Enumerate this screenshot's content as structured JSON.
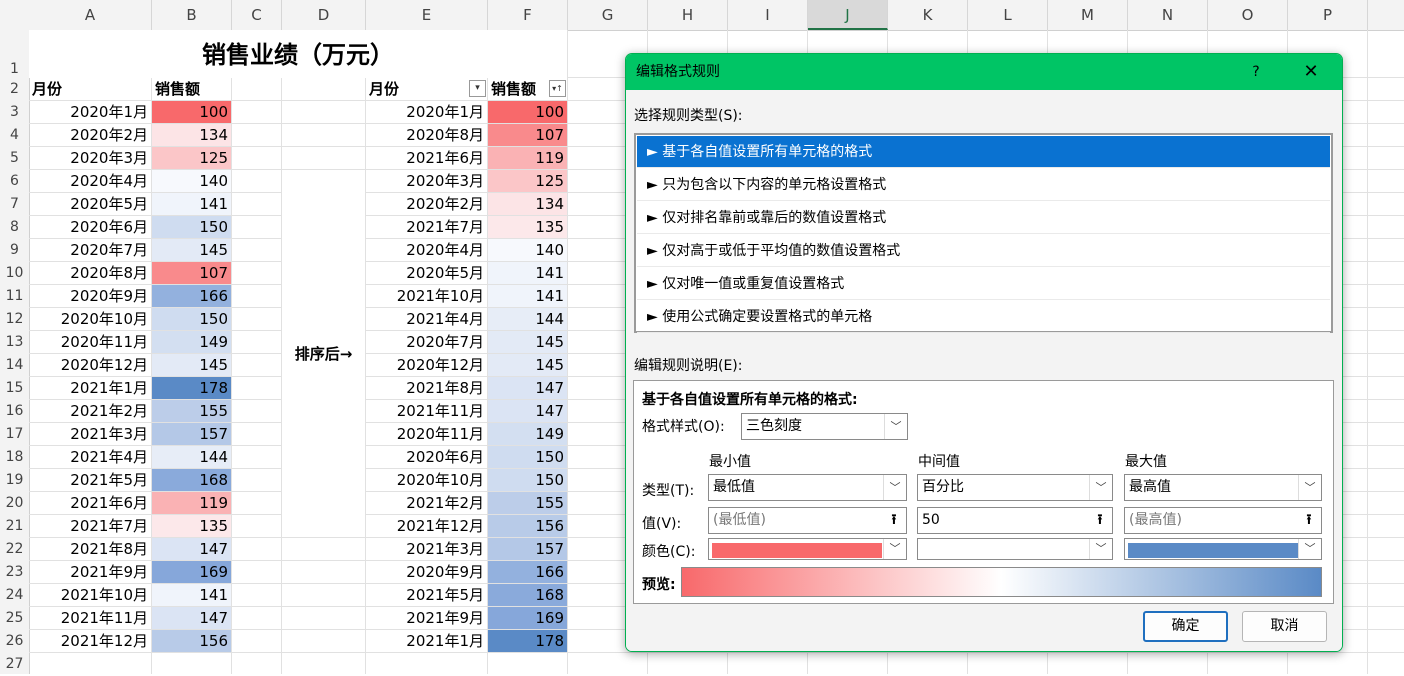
{
  "columns": [
    {
      "name": "A",
      "w": 123
    },
    {
      "name": "B",
      "w": 80
    },
    {
      "name": "C",
      "w": 50
    },
    {
      "name": "D",
      "w": 84
    },
    {
      "name": "E",
      "w": 122
    },
    {
      "name": "F",
      "w": 80
    },
    {
      "name": "G",
      "w": 80
    },
    {
      "name": "H",
      "w": 80
    },
    {
      "name": "I",
      "w": 80
    },
    {
      "name": "J",
      "w": 80
    },
    {
      "name": "K",
      "w": 80
    },
    {
      "name": "L",
      "w": 80
    },
    {
      "name": "M",
      "w": 80
    },
    {
      "name": "N",
      "w": 80
    },
    {
      "name": "O",
      "w": 80
    },
    {
      "name": "P",
      "w": 80
    }
  ],
  "selected_column": "J",
  "rows": [
    "1",
    "2",
    "3",
    "4",
    "5",
    "6",
    "7",
    "8",
    "9",
    "10",
    "11",
    "12",
    "13",
    "14",
    "15",
    "16",
    "17",
    "18",
    "19",
    "20",
    "21",
    "22",
    "23",
    "24",
    "25",
    "26",
    "27"
  ],
  "sheet": {
    "title": "销售业绩（万元）",
    "header_month": "月份",
    "header_sales": "销售额",
    "sort_label": "排序后→",
    "left_table": [
      {
        "month": "2020年1月",
        "value": "100",
        "color": "#f8696b"
      },
      {
        "month": "2020年2月",
        "value": "134",
        "color": "#fce4e6"
      },
      {
        "month": "2020年3月",
        "value": "125",
        "color": "#fbc6c8"
      },
      {
        "month": "2020年4月",
        "value": "140",
        "color": "#f7f9fd"
      },
      {
        "month": "2020年5月",
        "value": "141",
        "color": "#f0f4fb"
      },
      {
        "month": "2020年6月",
        "value": "150",
        "color": "#cfdcf0"
      },
      {
        "month": "2020年7月",
        "value": "145",
        "color": "#e3eaf6"
      },
      {
        "month": "2020年8月",
        "value": "107",
        "color": "#f98a8c"
      },
      {
        "month": "2020年9月",
        "value": "166",
        "color": "#93b1de"
      },
      {
        "month": "2020年10月",
        "value": "150",
        "color": "#cfdcf0"
      },
      {
        "month": "2020年11月",
        "value": "149",
        "color": "#d3dff1"
      },
      {
        "month": "2020年12月",
        "value": "145",
        "color": "#e3eaf6"
      },
      {
        "month": "2021年1月",
        "value": "178",
        "color": "#5a8ac6"
      },
      {
        "month": "2021年2月",
        "value": "155",
        "color": "#bccde9"
      },
      {
        "month": "2021年3月",
        "value": "157",
        "color": "#b4c8e7"
      },
      {
        "month": "2021年4月",
        "value": "144",
        "color": "#e7edf7"
      },
      {
        "month": "2021年5月",
        "value": "168",
        "color": "#8aaadb"
      },
      {
        "month": "2021年6月",
        "value": "119",
        "color": "#fab2b4"
      },
      {
        "month": "2021年7月",
        "value": "135",
        "color": "#fce8ea"
      },
      {
        "month": "2021年8月",
        "value": "147",
        "color": "#dbe4f4"
      },
      {
        "month": "2021年9月",
        "value": "169",
        "color": "#86a7da"
      },
      {
        "month": "2021年10月",
        "value": "141",
        "color": "#f0f4fb"
      },
      {
        "month": "2021年11月",
        "value": "147",
        "color": "#dbe4f4"
      },
      {
        "month": "2021年12月",
        "value": "156",
        "color": "#b8cbe8"
      }
    ],
    "right_table": [
      {
        "month": "2020年1月",
        "value": "100",
        "color": "#f8696b"
      },
      {
        "month": "2020年8月",
        "value": "107",
        "color": "#f98a8c"
      },
      {
        "month": "2021年6月",
        "value": "119",
        "color": "#fab2b4"
      },
      {
        "month": "2020年3月",
        "value": "125",
        "color": "#fbc6c8"
      },
      {
        "month": "2020年2月",
        "value": "134",
        "color": "#fce4e6"
      },
      {
        "month": "2021年7月",
        "value": "135",
        "color": "#fce8ea"
      },
      {
        "month": "2020年4月",
        "value": "140",
        "color": "#f7f9fd"
      },
      {
        "month": "2020年5月",
        "value": "141",
        "color": "#f0f4fb"
      },
      {
        "month": "2021年10月",
        "value": "141",
        "color": "#f0f4fb"
      },
      {
        "month": "2021年4月",
        "value": "144",
        "color": "#e7edf7"
      },
      {
        "month": "2020年7月",
        "value": "145",
        "color": "#e3eaf6"
      },
      {
        "month": "2020年12月",
        "value": "145",
        "color": "#e3eaf6"
      },
      {
        "month": "2021年8月",
        "value": "147",
        "color": "#dbe4f4"
      },
      {
        "month": "2021年11月",
        "value": "147",
        "color": "#dbe4f4"
      },
      {
        "month": "2020年11月",
        "value": "149",
        "color": "#d3dff1"
      },
      {
        "month": "2020年6月",
        "value": "150",
        "color": "#cfdcf0"
      },
      {
        "month": "2020年10月",
        "value": "150",
        "color": "#cfdcf0"
      },
      {
        "month": "2021年2月",
        "value": "155",
        "color": "#bccde9"
      },
      {
        "month": "2021年12月",
        "value": "156",
        "color": "#b8cbe8"
      },
      {
        "month": "2021年3月",
        "value": "157",
        "color": "#b4c8e7"
      },
      {
        "month": "2020年9月",
        "value": "166",
        "color": "#93b1de"
      },
      {
        "month": "2021年5月",
        "value": "168",
        "color": "#8aaadb"
      },
      {
        "month": "2021年9月",
        "value": "169",
        "color": "#86a7da"
      },
      {
        "month": "2021年1月",
        "value": "178",
        "color": "#5a8ac6"
      }
    ],
    "filter_icon_month": "chevron-down-icon",
    "filter_icon_sales": "sort-filter-icon"
  },
  "dialog": {
    "title": "编辑格式规则",
    "help": "?",
    "close": "✕",
    "rule_type_label": "选择规则类型(S):",
    "rule_types": [
      "► 基于各自值设置所有单元格的格式",
      "► 只为包含以下内容的单元格设置格式",
      "► 仅对排名靠前或靠后的数值设置格式",
      "► 仅对高于或低于平均值的数值设置格式",
      "► 仅对唯一值或重复值设置格式",
      "► 使用公式确定要设置格式的单元格"
    ],
    "selected_rule": 0,
    "desc_label": "编辑规则说明(E):",
    "desc_heading": "基于各自值设置所有单元格的格式:",
    "format_style_label": "格式样式(O):",
    "format_style_value": "三色刻度",
    "col_min": "最小值",
    "col_mid": "中间值",
    "col_max": "最大值",
    "type_label": "类型(T):",
    "value_label": "值(V):",
    "color_label": "颜色(C):",
    "min_type": "最低值",
    "mid_type": "百分比",
    "max_type": "最高值",
    "min_value_placeholder": "(最低值)",
    "mid_value": "50",
    "max_value_placeholder": "(最高值)",
    "min_color": "#f8696b",
    "mid_color": "#ffffff",
    "max_color": "#5a8ac6",
    "preview_label": "预览:",
    "ok": "确定",
    "cancel": "取消"
  }
}
